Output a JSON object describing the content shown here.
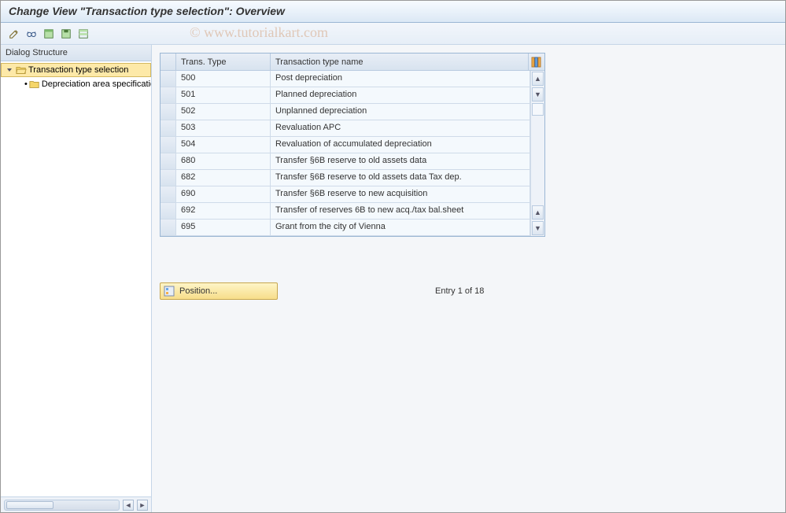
{
  "title": "Change View \"Transaction type selection\": Overview",
  "watermark": "© www.tutorialkart.com",
  "toolbar": {
    "icons": [
      "change-icon",
      "glasses-icon",
      "select-all-icon",
      "save-icon",
      "select-block-icon"
    ]
  },
  "dialog_structure": {
    "header": "Dialog Structure",
    "root_label": "Transaction type selection",
    "child_label": "Depreciation area specification"
  },
  "table": {
    "col_trans_type": "Trans. Type",
    "col_name": "Transaction type name",
    "rows": [
      {
        "type": "500",
        "name": "Post depreciation"
      },
      {
        "type": "501",
        "name": "Planned depreciation"
      },
      {
        "type": "502",
        "name": "Unplanned depreciation"
      },
      {
        "type": "503",
        "name": "Revaluation APC"
      },
      {
        "type": "504",
        "name": "Revaluation of accumulated depreciation"
      },
      {
        "type": "680",
        "name": "Transfer §6B reserve to old assets data"
      },
      {
        "type": "682",
        "name": "Transfer §6B reserve to old assets data  Tax dep."
      },
      {
        "type": "690",
        "name": "Transfer §6B reserve to new acquisition"
      },
      {
        "type": "692",
        "name": "Transfer of reserves 6B to new acq./tax bal.sheet"
      },
      {
        "type": "695",
        "name": "Grant from the city of Vienna"
      }
    ]
  },
  "position_button_label": "Position...",
  "entry_status": "Entry 1 of 18"
}
